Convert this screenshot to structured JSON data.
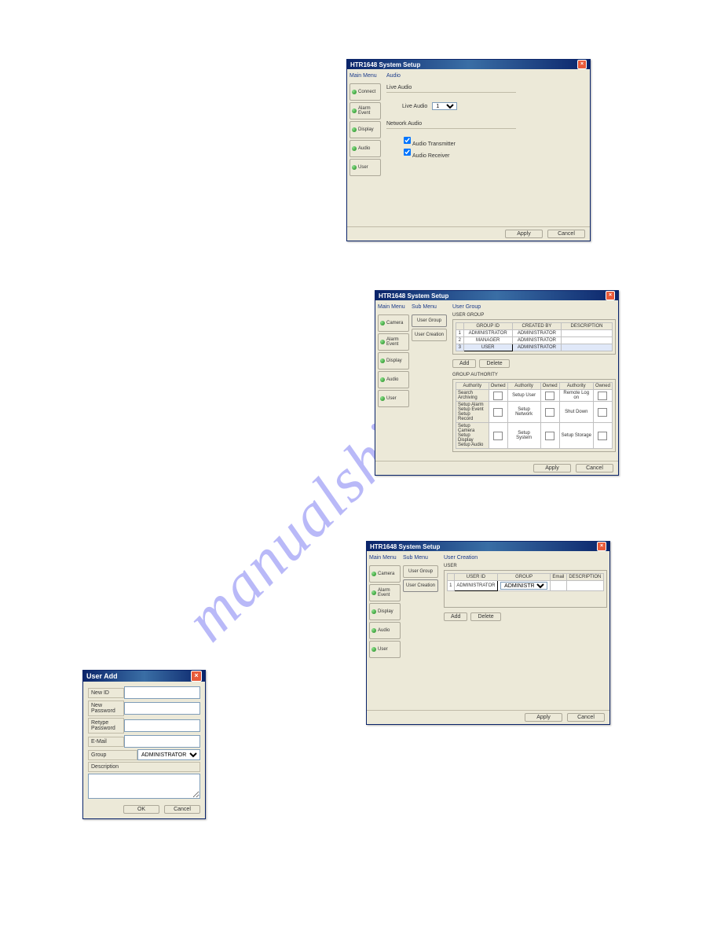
{
  "watermark": "manualshive.com",
  "windows": {
    "audio": {
      "title": "HTR1648 System Setup",
      "mainmenu_header": "Main Menu",
      "content_header": "Audio",
      "menu": [
        "Connect",
        "Alarm Event",
        "Display",
        "Audio",
        "User"
      ],
      "live_audio_section": "Live Audio",
      "live_audio_label": "Live Audio",
      "live_audio_value": "1",
      "network_audio_section": "Network Audio",
      "audio_transmitter": "Audio Transmitter",
      "audio_receiver": "Audio Receiver",
      "apply": "Apply",
      "cancel": "Cancel"
    },
    "usergroup": {
      "title": "HTR1648 System Setup",
      "mainmenu_header": "Main Menu",
      "submenu_header": "Sub Menu",
      "content_header": "User Group",
      "menu": [
        "Camera",
        "Alarm Event",
        "Display",
        "Audio",
        "User"
      ],
      "submenu": [
        "User Group",
        "User Creation"
      ],
      "usergroup_label": "USER GROUP",
      "ug_headers": [
        "",
        "GROUP ID",
        "CREATED BY",
        "DESCRIPTION"
      ],
      "ug_rows": [
        [
          "1",
          "ADMINISTRATOR",
          "ADMINISTRATOR",
          ""
        ],
        [
          "2",
          "MANAGER",
          "ADMINISTRATOR",
          ""
        ],
        [
          "3",
          "USER",
          "ADMINISTRATOR",
          ""
        ]
      ],
      "add": "Add",
      "delete": "Delete",
      "group_authority_label": "GROUP AUTHORITY",
      "ga_headers": [
        "Authority",
        "Owned",
        "Authority",
        "Owned",
        "Authority",
        "Owned"
      ],
      "ga_rows": [
        [
          "Search",
          "",
          "Setup User",
          "",
          "Remote Log on",
          ""
        ],
        [
          "Archiving",
          "",
          "",
          "",
          "",
          ""
        ],
        [
          "Setup Alarm",
          "",
          "Setup Network",
          "",
          "Shut Down",
          ""
        ],
        [
          "Setup Event",
          "",
          "",
          "",
          "",
          ""
        ],
        [
          "Setup Record",
          "",
          "",
          "",
          "",
          ""
        ],
        [
          "Setup Camera",
          "",
          "Setup System",
          "",
          "Setup Storage",
          ""
        ],
        [
          "Setup Display",
          "",
          "",
          "",
          "",
          ""
        ],
        [
          "Setup Audio",
          "",
          "",
          "",
          "",
          ""
        ]
      ],
      "ga_display": [
        {
          "cells": [
            "Search / Archiving",
            true,
            "Setup User",
            true,
            "Remote Log on",
            true
          ]
        },
        {
          "cells": [
            "Setup Alarm / Setup Event / Setup Record",
            true,
            "Setup Network",
            true,
            "Shut Down",
            true
          ]
        },
        {
          "cells": [
            "Setup Camera / Setup Display / Setup Audio",
            true,
            "Setup System",
            true,
            "Setup Storage",
            true
          ]
        }
      ],
      "apply": "Apply",
      "cancel": "Cancel"
    },
    "usercreation": {
      "title": "HTR1648 System Setup",
      "mainmenu_header": "Main Menu",
      "submenu_header": "Sub Menu",
      "content_header": "User Creation",
      "menu": [
        "Camera",
        "Alarm Event",
        "Display",
        "Audio",
        "User"
      ],
      "submenu": [
        "User Group",
        "User Creation"
      ],
      "user_label": "USER",
      "headers": [
        "",
        "USER ID",
        "GROUP",
        "Email",
        "DESCRIPTION"
      ],
      "row1": [
        "1",
        "ADMINISTRATOR",
        "ADMINISTRATOR",
        "",
        ""
      ],
      "add": "Add",
      "delete": "Delete",
      "apply": "Apply",
      "cancel": "Cancel"
    },
    "useradd": {
      "title": "User Add",
      "new_id": "New ID",
      "new_password": "New Password",
      "retype_password": "Retype Password",
      "email": "E-Mail",
      "group": "Group",
      "group_value": "ADMINISTRATOR",
      "description": "Description",
      "ok": "OK",
      "cancel": "Cancel"
    }
  }
}
